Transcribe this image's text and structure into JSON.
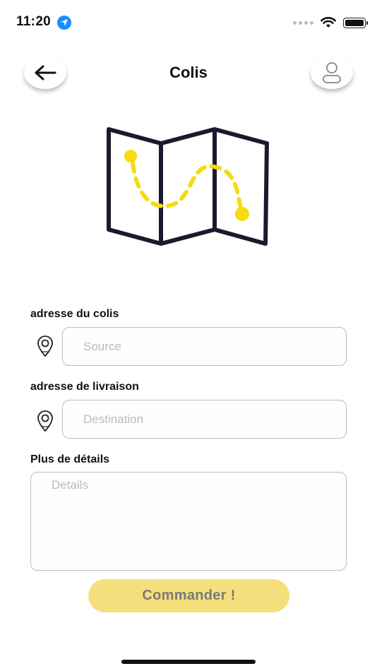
{
  "status_bar": {
    "time": "11:20",
    "icons": [
      "location-arrow-icon",
      "signal-dots-icon",
      "wifi-icon",
      "battery-icon"
    ]
  },
  "header": {
    "title": "Colis",
    "back_icon": "arrow-left-icon",
    "profile_icon": "user-icon"
  },
  "hero": {
    "icon": "folded-map-route-icon",
    "colors": {
      "outline": "#1a1a2e",
      "route": "#f5dc12"
    }
  },
  "form": {
    "source": {
      "label": "adresse du colis",
      "placeholder": "Source",
      "value": "",
      "icon": "map-pin-icon"
    },
    "destination": {
      "label": "adresse de livraison",
      "placeholder": "Destination",
      "value": "",
      "icon": "map-pin-icon"
    },
    "details": {
      "label": "Plus de détails",
      "placeholder": "Details",
      "value": ""
    },
    "submit_label": "Commander !"
  },
  "colors": {
    "button": "#f5df7d",
    "button_text": "#7a7a7a",
    "border": "#bdbdbd",
    "placeholder": "#bbbbbb"
  }
}
